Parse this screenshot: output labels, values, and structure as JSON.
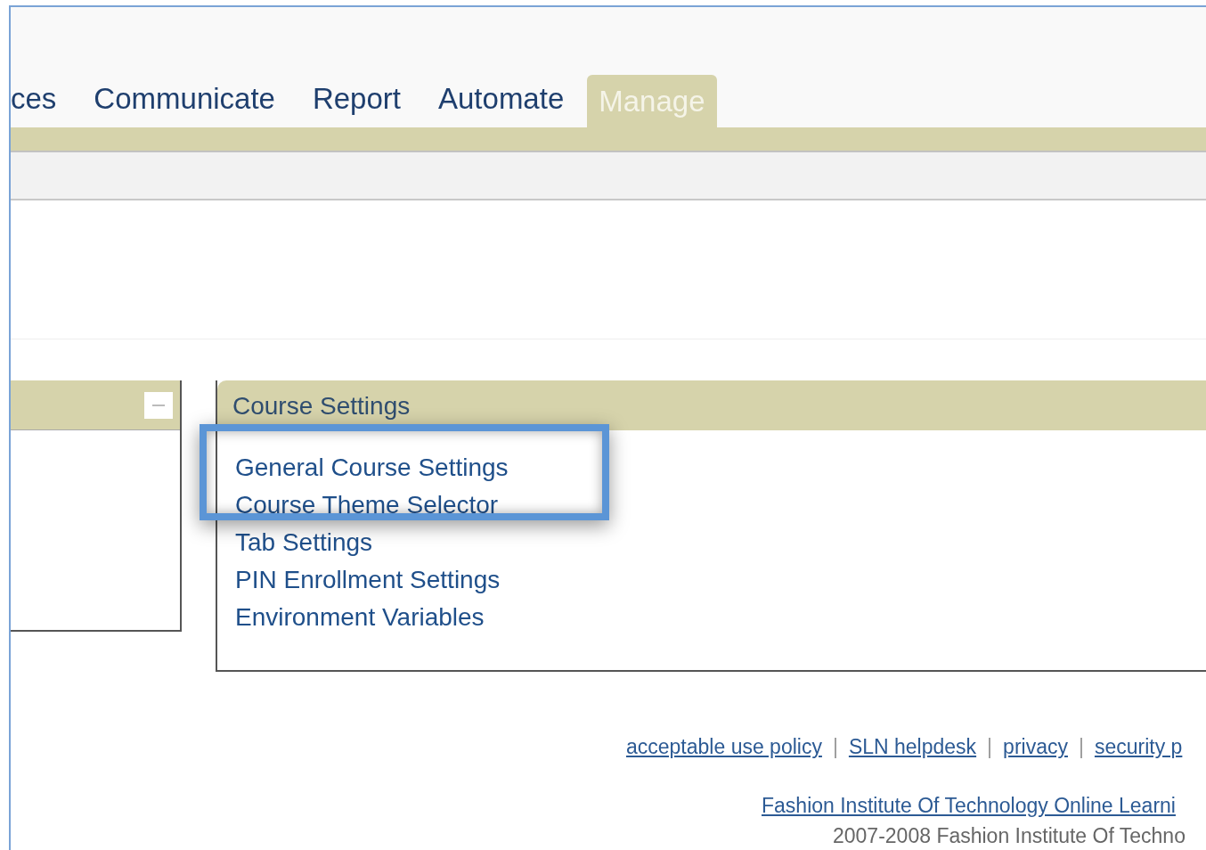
{
  "tabs": [
    {
      "label": "ces",
      "selected": false
    },
    {
      "label": "Communicate",
      "selected": false
    },
    {
      "label": "Report",
      "selected": false
    },
    {
      "label": "Automate",
      "selected": false
    },
    {
      "label": "Manage",
      "selected": true
    }
  ],
  "left_panel": {
    "collapsed": false
  },
  "course_settings": {
    "title": "Course Settings",
    "highlight_frame": true,
    "links": [
      {
        "label": "General Course Settings"
      },
      {
        "label": "Course Theme Selector"
      },
      {
        "label": "Tab Settings"
      },
      {
        "label": "PIN Enrollment Settings"
      },
      {
        "label": "Environment Variables"
      }
    ]
  },
  "footer": {
    "items": [
      {
        "kind": "link",
        "text": "acceptable use policy"
      },
      {
        "kind": "separator",
        "text": "|"
      },
      {
        "kind": "link",
        "text": "SLN helpdesk"
      },
      {
        "kind": "separator",
        "text": "|"
      },
      {
        "kind": "link",
        "text": "privacy"
      },
      {
        "kind": "separator",
        "text": "|"
      },
      {
        "kind": "link",
        "text": "security p"
      }
    ],
    "institution_link": "Fashion Institute Of Technology Online Learni",
    "copyright": "2007-2008 Fashion Institute Of Techno"
  }
}
